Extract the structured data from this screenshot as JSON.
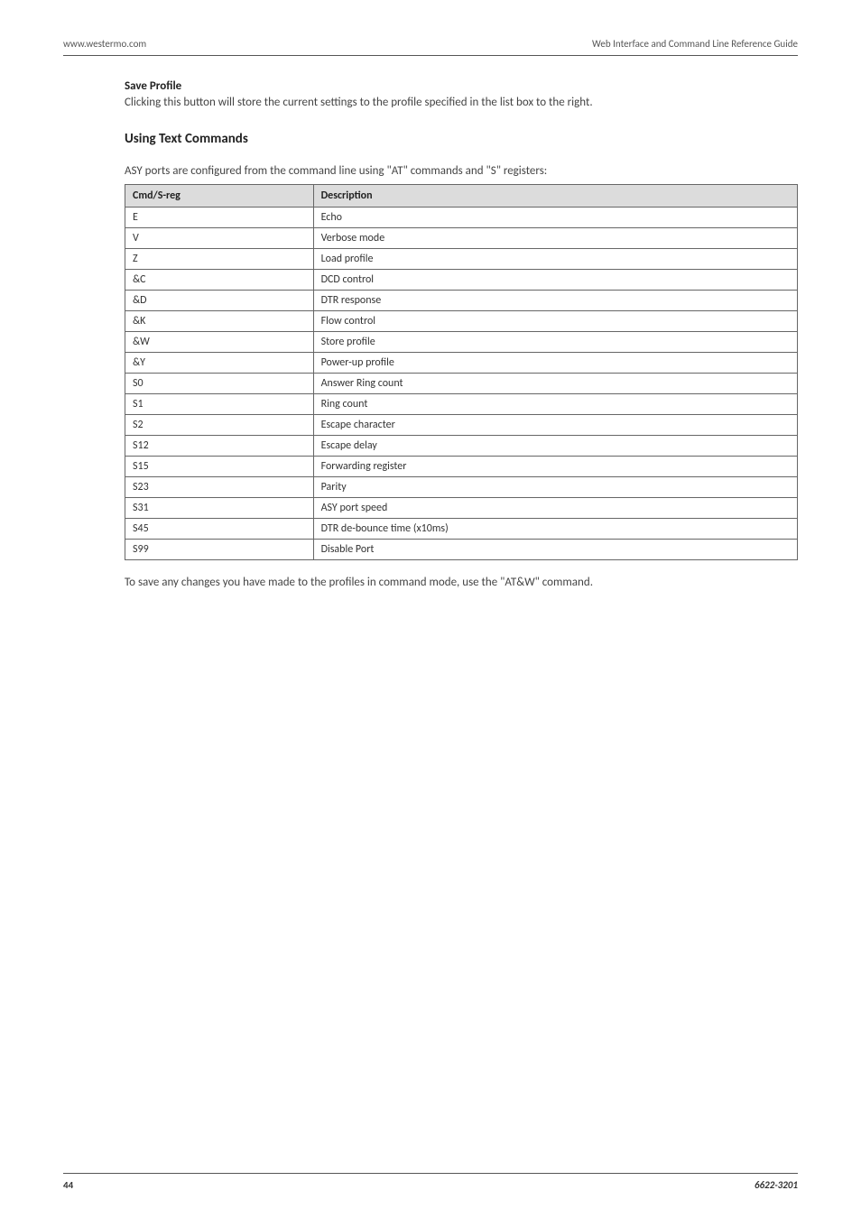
{
  "header": {
    "left": "www.westermo.com",
    "right": "Web Interface and Command Line Reference Guide"
  },
  "section_save_profile": {
    "title": "Save Profile",
    "body": "Clicking this button will store the current settings to the profile specified in the list box to the right."
  },
  "section_using_text": {
    "title": "Using Text Commands",
    "intro": "ASY ports are configured from the command line using \"AT\" commands and \"S\" registers:",
    "table_headers": {
      "col1": "Cmd/S-reg",
      "col2": "Description"
    },
    "rows": [
      {
        "cmd": "E",
        "desc": "Echo"
      },
      {
        "cmd": "V",
        "desc": "Verbose mode"
      },
      {
        "cmd": "Z",
        "desc": "Load profile"
      },
      {
        "cmd": "&C",
        "desc": "DCD control"
      },
      {
        "cmd": "&D",
        "desc": "DTR response"
      },
      {
        "cmd": "&K",
        "desc": "Flow control"
      },
      {
        "cmd": "&W",
        "desc": "Store profile"
      },
      {
        "cmd": "&Y",
        "desc": "Power-up profile"
      },
      {
        "cmd": "S0",
        "desc": "Answer Ring count"
      },
      {
        "cmd": "S1",
        "desc": "Ring count"
      },
      {
        "cmd": "S2",
        "desc": "Escape character"
      },
      {
        "cmd": "S12",
        "desc": "Escape delay"
      },
      {
        "cmd": "S15",
        "desc": "Forwarding register"
      },
      {
        "cmd": "S23",
        "desc": "Parity"
      },
      {
        "cmd": "S31",
        "desc": "ASY port speed"
      },
      {
        "cmd": "S45",
        "desc": "DTR de-bounce time (x10ms)"
      },
      {
        "cmd": "S99",
        "desc": "Disable Port"
      }
    ],
    "outro": "To save any changes you have made to the profiles in command mode, use the \"AT&W\" command."
  },
  "footer": {
    "page_number": "44",
    "doc_id": "6622-3201"
  }
}
